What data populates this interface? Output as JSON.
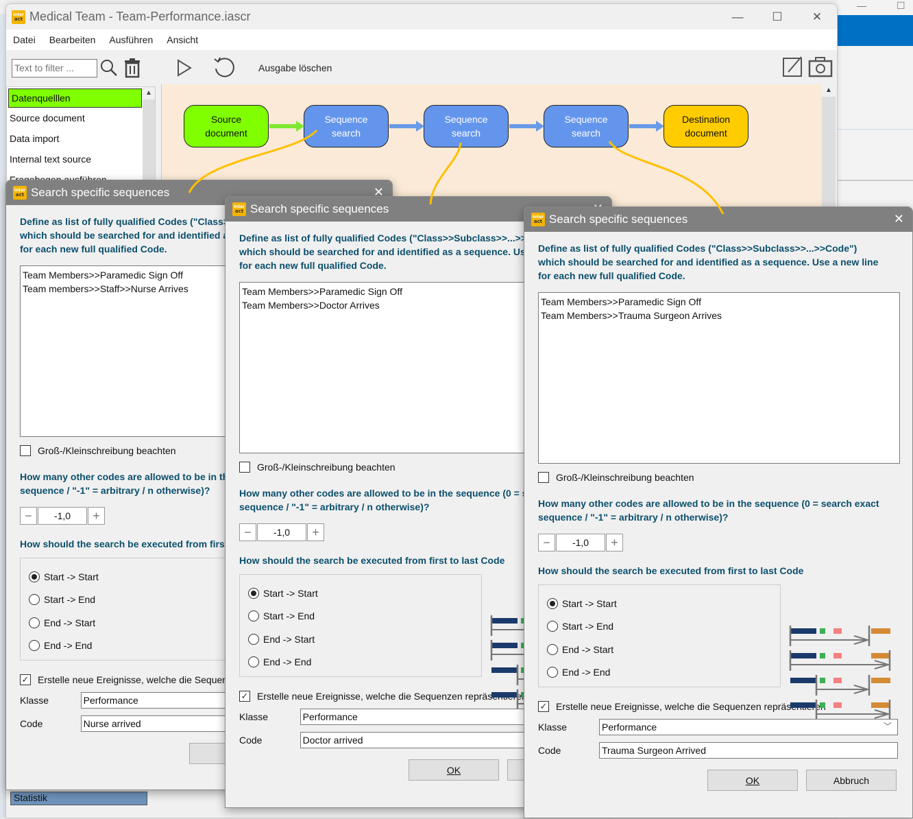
{
  "main_window": {
    "title": "Medical Team - Team-Performance.iascr",
    "controls": {
      "minimize": "—",
      "maximize": "☐",
      "close": "✕"
    },
    "menu": [
      "Datei",
      "Bearbeiten",
      "Ausführen",
      "Ansicht"
    ],
    "filter": {
      "placeholder": "Text to filter ..."
    },
    "tree_items": [
      {
        "label": "Datenquelllen",
        "selected": true
      },
      {
        "label": "Source document"
      },
      {
        "label": "Data import"
      },
      {
        "label": "Internal text source"
      },
      {
        "label": "Fragebogen ausführen"
      }
    ],
    "bottom_tree_item": "Statistik",
    "toolbar": {
      "clear_output_label": "Ausgabe löschen"
    }
  },
  "workflow": {
    "nodes": [
      {
        "label_1": "Source",
        "label_2": "document",
        "type": "source"
      },
      {
        "label_1": "Sequence",
        "label_2": "search",
        "type": "seq"
      },
      {
        "label_1": "Sequence",
        "label_2": "search",
        "type": "seq"
      },
      {
        "label_1": "Sequence",
        "label_2": "search",
        "type": "seq"
      },
      {
        "label_1": "Destination",
        "label_2": "document",
        "type": "dest"
      }
    ],
    "colors": {
      "source": "#80ff00",
      "seq": "#6495ed",
      "dest": "#ffcc00",
      "connector": "#ffc000",
      "canvas": "#fbead7"
    }
  },
  "common": {
    "dialog_title": "Search specific sequences",
    "desc_line1": "Define as list of fully qualified Codes (\"Class>>Subclass>>...>>Code\")",
    "desc_line2": "which should be searched for and identified as a sequence. Use a new line",
    "desc_line3": "for each new full qualified Code.",
    "case_label": "Groß-/Kleinschreibung beachten",
    "q1_line1": "How many other codes are allowed to be in the sequence (0 = search exact",
    "q1_line2": "sequence / \"-1\" = arbitrary / n otherwise)?",
    "q2": "How should the search be executed from first to last Code",
    "radio_options": [
      "Start -> Start",
      "Start -> End",
      "End -> Start",
      "End -> End"
    ],
    "create_events_label": "Erstelle neue Ereignisse, welche die Sequenzen repräsentieren",
    "klasse_label": "Klasse",
    "code_label": "Code",
    "ok_label": "OK",
    "cancel_label": "Abbruch",
    "minus": "−",
    "plus": "+"
  },
  "dialogs": [
    {
      "codes": "Team Members>>Paramedic Sign Off\nTeam members>>Staff>>Nurse Arrives",
      "case_sensitive": false,
      "other_codes_allowed": "-1,0",
      "selected_mode": "Start -> Start",
      "create_events": true,
      "klasse": "Performance",
      "code": "Nurse arrived"
    },
    {
      "codes": "Team Members>>Paramedic Sign Off\nTeam Members>>Doctor Arrives",
      "case_sensitive": false,
      "other_codes_allowed": "-1,0",
      "selected_mode": "Start -> Start",
      "create_events": true,
      "klasse": "Performance",
      "code": "Doctor arrived"
    },
    {
      "codes": "Team Members>>Paramedic Sign Off\nTeam Members>>Trauma Surgeon Arrives",
      "case_sensitive": false,
      "other_codes_allowed": "-1,0",
      "selected_mode": "Start -> Start",
      "create_events": true,
      "klasse": "Performance",
      "code": "Trauma Surgeon Arrived"
    }
  ]
}
